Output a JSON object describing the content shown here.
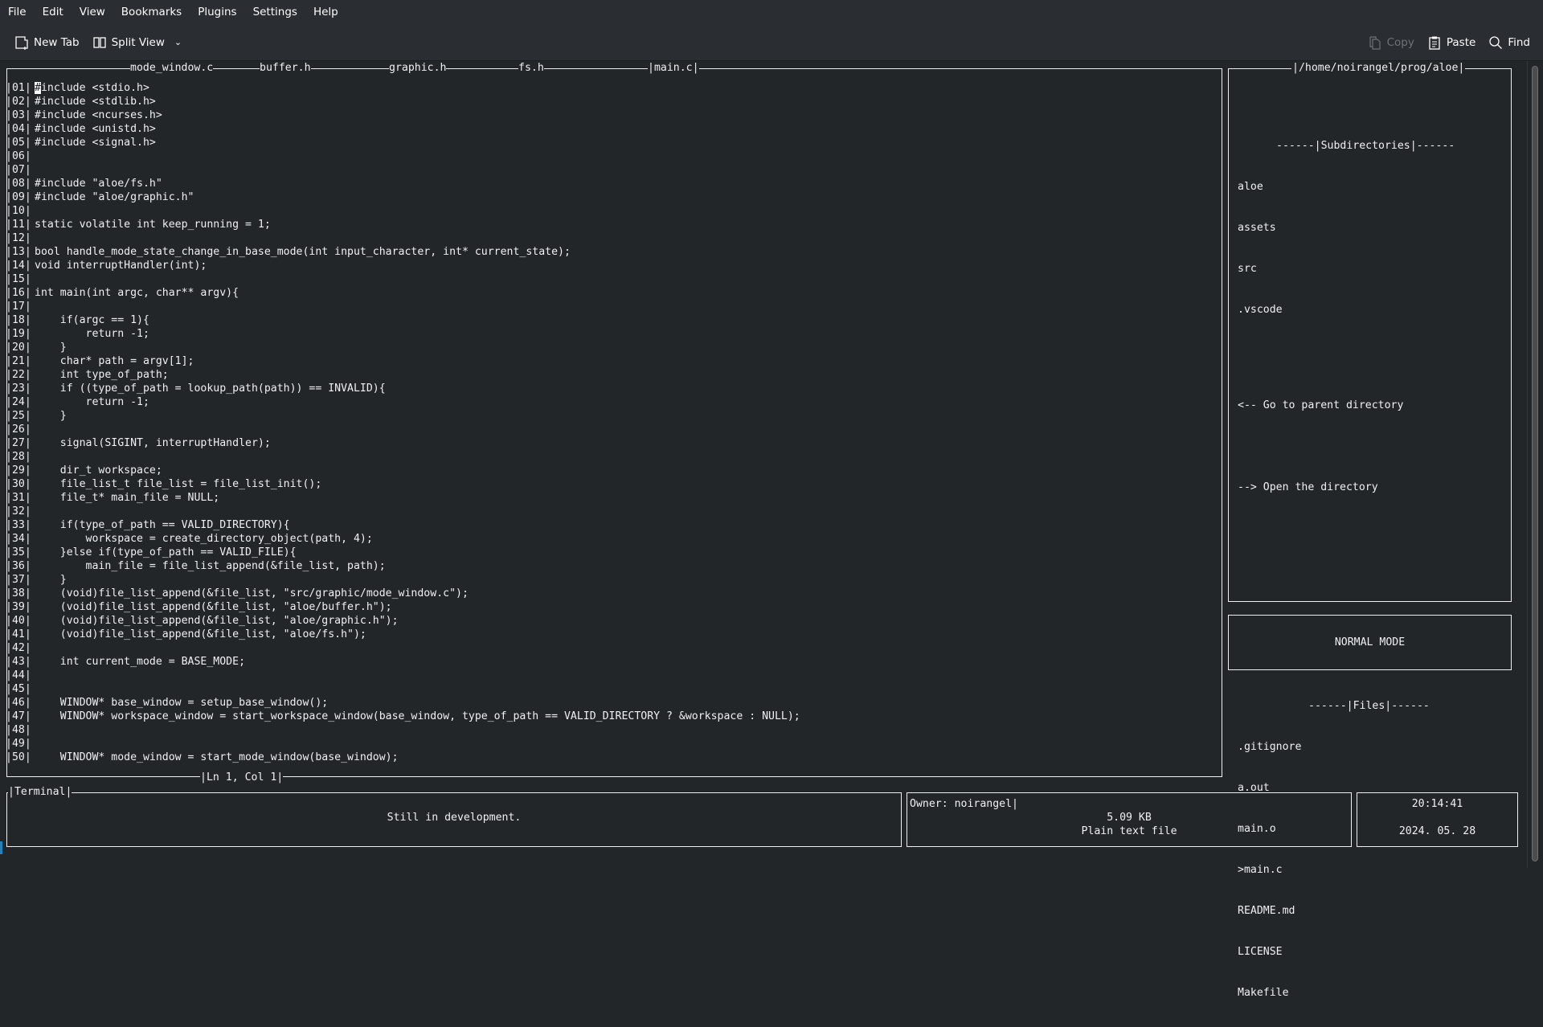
{
  "menubar": {
    "items": [
      "File",
      "Edit",
      "View",
      "Bookmarks",
      "Plugins",
      "Settings",
      "Help"
    ]
  },
  "toolbar": {
    "new_tab": "New Tab",
    "split_view": "Split View",
    "copy": "Copy",
    "paste": "Paste",
    "find": "Find"
  },
  "editor": {
    "tabs": [
      "mode_window.c",
      "buffer.h",
      "graphic.h",
      "fs.h",
      "|main.c|"
    ],
    "active_tab": "main.c",
    "cursor_position": "|Ln 1, Col 1|",
    "lines": [
      {
        "n": "|01|",
        "text": "#include <stdio.h>"
      },
      {
        "n": "|02|",
        "text": "#include <stdlib.h>"
      },
      {
        "n": "|03|",
        "text": "#include <ncurses.h>"
      },
      {
        "n": "|04|",
        "text": "#include <unistd.h>"
      },
      {
        "n": "|05|",
        "text": "#include <signal.h>"
      },
      {
        "n": "|06|",
        "text": ""
      },
      {
        "n": "|07|",
        "text": ""
      },
      {
        "n": "|08|",
        "text": "#include \"aloe/fs.h\""
      },
      {
        "n": "|09|",
        "text": "#include \"aloe/graphic.h\""
      },
      {
        "n": "|10|",
        "text": ""
      },
      {
        "n": "|11|",
        "text": "static volatile int keep_running = 1;"
      },
      {
        "n": "|12|",
        "text": ""
      },
      {
        "n": "|13|",
        "text": "bool handle_mode_state_change_in_base_mode(int input_character, int* current_state);"
      },
      {
        "n": "|14|",
        "text": "void interruptHandler(int);"
      },
      {
        "n": "|15|",
        "text": ""
      },
      {
        "n": "|16|",
        "text": "int main(int argc, char** argv){"
      },
      {
        "n": "|17|",
        "text": ""
      },
      {
        "n": "|18|",
        "text": "    if(argc == 1){"
      },
      {
        "n": "|19|",
        "text": "        return -1;"
      },
      {
        "n": "|20|",
        "text": "    }"
      },
      {
        "n": "|21|",
        "text": "    char* path = argv[1];"
      },
      {
        "n": "|22|",
        "text": "    int type_of_path;"
      },
      {
        "n": "|23|",
        "text": "    if ((type_of_path = lookup_path(path)) == INVALID){"
      },
      {
        "n": "|24|",
        "text": "        return -1;"
      },
      {
        "n": "|25|",
        "text": "    }"
      },
      {
        "n": "|26|",
        "text": ""
      },
      {
        "n": "|27|",
        "text": "    signal(SIGINT, interruptHandler);"
      },
      {
        "n": "|28|",
        "text": ""
      },
      {
        "n": "|29|",
        "text": "    dir_t workspace;"
      },
      {
        "n": "|30|",
        "text": "    file_list_t file_list = file_list_init();"
      },
      {
        "n": "|31|",
        "text": "    file_t* main_file = NULL;"
      },
      {
        "n": "|32|",
        "text": ""
      },
      {
        "n": "|33|",
        "text": "    if(type_of_path == VALID_DIRECTORY){"
      },
      {
        "n": "|34|",
        "text": "        workspace = create_directory_object(path, 4);"
      },
      {
        "n": "|35|",
        "text": "    }else if(type_of_path == VALID_FILE){"
      },
      {
        "n": "|36|",
        "text": "        main_file = file_list_append(&file_list, path);"
      },
      {
        "n": "|37|",
        "text": "    }"
      },
      {
        "n": "|38|",
        "text": "    (void)file_list_append(&file_list, \"src/graphic/mode_window.c\");"
      },
      {
        "n": "|39|",
        "text": "    (void)file_list_append(&file_list, \"aloe/buffer.h\");"
      },
      {
        "n": "|40|",
        "text": "    (void)file_list_append(&file_list, \"aloe/graphic.h\");"
      },
      {
        "n": "|41|",
        "text": "    (void)file_list_append(&file_list, \"aloe/fs.h\");"
      },
      {
        "n": "|42|",
        "text": ""
      },
      {
        "n": "|43|",
        "text": "    int current_mode = BASE_MODE;"
      },
      {
        "n": "|44|",
        "text": ""
      },
      {
        "n": "|45|",
        "text": ""
      },
      {
        "n": "|46|",
        "text": "    WINDOW* base_window = setup_base_window();"
      },
      {
        "n": "|47|",
        "text": "    WINDOW* workspace_window = start_workspace_window(base_window, type_of_path == VALID_DIRECTORY ? &workspace : NULL);"
      },
      {
        "n": "|48|",
        "text": ""
      },
      {
        "n": "|49|",
        "text": ""
      },
      {
        "n": "|50|",
        "text": "    WINDOW* mode_window = start_mode_window(base_window);"
      }
    ]
  },
  "workspace": {
    "title": "|/home/noirangel/prog/aloe|",
    "subdirectories_header": "------|Subdirectories|------",
    "subdirectories": [
      "aloe",
      "assets",
      "src",
      ".vscode"
    ],
    "go_parent": "<-- Go to parent directory",
    "open_dir": "--> Open the directory",
    "files_header": "------|Files|------",
    "files": [
      ".gitignore",
      "a.out",
      "main.o",
      ">main.c",
      "README.md",
      "LICENSE",
      "Makefile"
    ]
  },
  "mode": {
    "label": "NORMAL MODE"
  },
  "terminal": {
    "title": "|Terminal|",
    "message": "Still in development."
  },
  "file_info": {
    "owner": "Owner: noirangel|",
    "size": "5.09 KB",
    "type": "Plain text file"
  },
  "clock": {
    "time": "20:14:41",
    "date": "2024. 05. 28"
  }
}
